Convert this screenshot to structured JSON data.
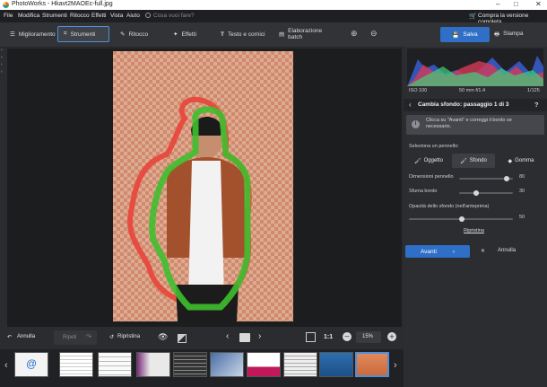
{
  "window": {
    "title": "PhotoWorks - Hkavt2MAOEc-full.jpg"
  },
  "menu": {
    "items": [
      "File",
      "Modifica",
      "Strumenti",
      "Ritocco",
      "Effetti",
      "Vista",
      "Aiuto"
    ],
    "search_placeholder": "Cosa vuoi fare?",
    "buy_label": "Compra la versione completa"
  },
  "toolbar": {
    "tabs": [
      "Miglioramento",
      "Strumenti",
      "Ritocco",
      "Effetti",
      "Testo e cornici",
      "Elaborazione batch"
    ],
    "active_tab": "Strumenti",
    "save_label": "Salva",
    "print_label": "Stampa"
  },
  "histogram": {
    "iso": "ISO 100",
    "focal": "50 mm f/1.4",
    "shutter": "1/125"
  },
  "wizard": {
    "title": "Cambia sfondo: passaggio 1 di 3",
    "help": "?",
    "info": "Clicca su \"Avanti\" e correggi il bordo se necessario.",
    "select_brush": "Seleziona un pennello:",
    "brushes": [
      "Oggetto",
      "Sfondo",
      "Gomma"
    ],
    "active_brush": "Sfondo",
    "brush_size_label": "Dimensioni pennello",
    "brush_size": "80",
    "feather_label": "Sfuma bordo",
    "feather": "30",
    "opacity_label": "Opacità dello sfondo (nell'anteprima)",
    "opacity": "50",
    "reset_label": "Ripristina",
    "next_label": "Avanti",
    "cancel_label": "Annulla"
  },
  "bottom": {
    "undo": "Annulla",
    "redo": "Ripeti",
    "restore": "Ripristina",
    "zoom_ratio": "1:1",
    "zoom": "15%"
  },
  "colors": {
    "accent": "#2f6fc7",
    "object_brush": "#3fbf2f",
    "background_brush": "#e8443a"
  }
}
